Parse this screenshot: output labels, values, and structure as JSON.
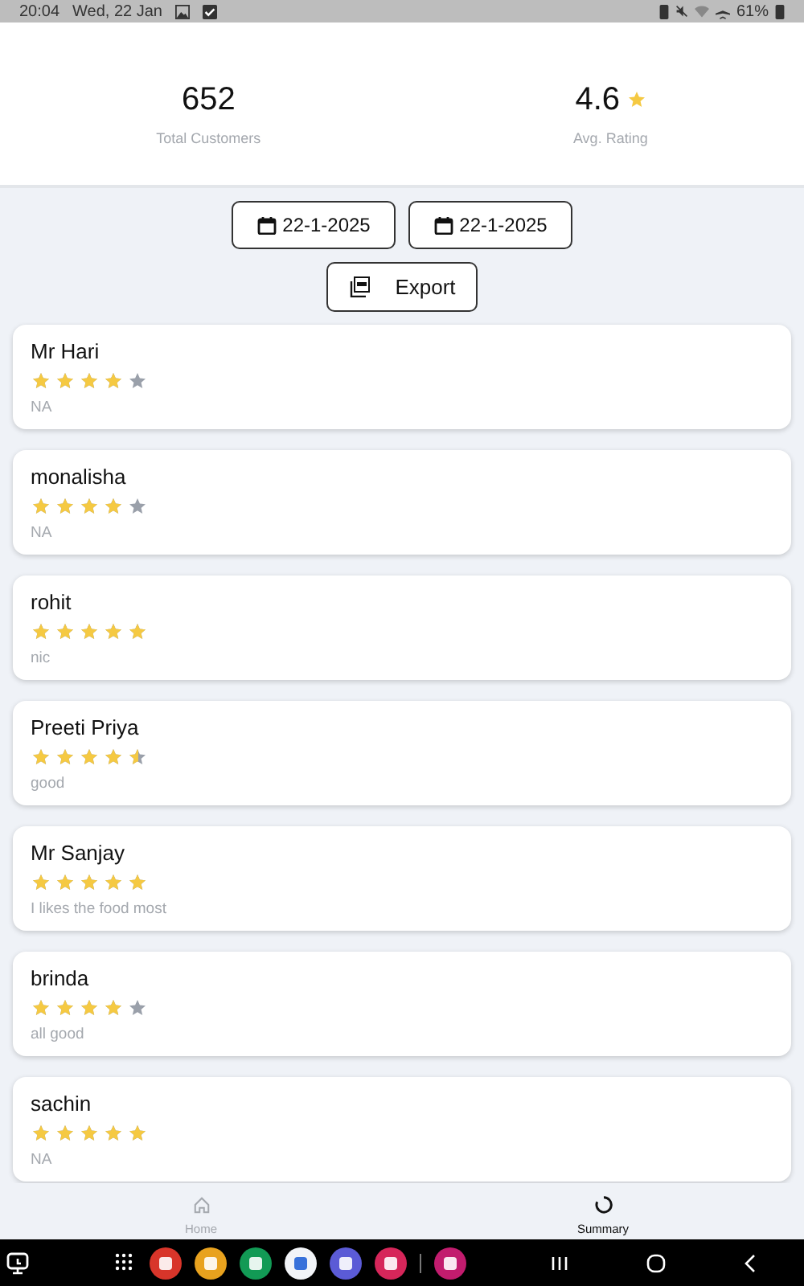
{
  "status_bar": {
    "time": "20:04",
    "date": "Wed, 22 Jan",
    "battery": "61%"
  },
  "stats": [
    {
      "kind": "count",
      "value": "652",
      "label": "Total Customers"
    },
    {
      "kind": "rating",
      "value": "4.6",
      "label": "Avg. Rating"
    }
  ],
  "filters": {
    "from_date": "22-1-2025",
    "to_date": "22-1-2025",
    "export": "Export"
  },
  "reviews": [
    {
      "name": "Mr Hari",
      "stars": 4,
      "comment": "NA"
    },
    {
      "name": "monalisha",
      "stars": 4,
      "comment": "NA"
    },
    {
      "name": "rohit",
      "stars": 5,
      "comment": "nic"
    },
    {
      "name": "Preeti Priya",
      "stars": 4.5,
      "comment": "good"
    },
    {
      "name": "Mr Sanjay",
      "stars": 5,
      "comment": "I likes the food most"
    },
    {
      "name": "brinda",
      "stars": 4,
      "comment": "all good"
    },
    {
      "name": "sachin",
      "stars": 5,
      "comment": "NA"
    }
  ],
  "bottom_nav": [
    {
      "label": "Home",
      "kind": "home",
      "selected": false
    },
    {
      "label": "Summary",
      "kind": "summary",
      "selected": true
    }
  ]
}
